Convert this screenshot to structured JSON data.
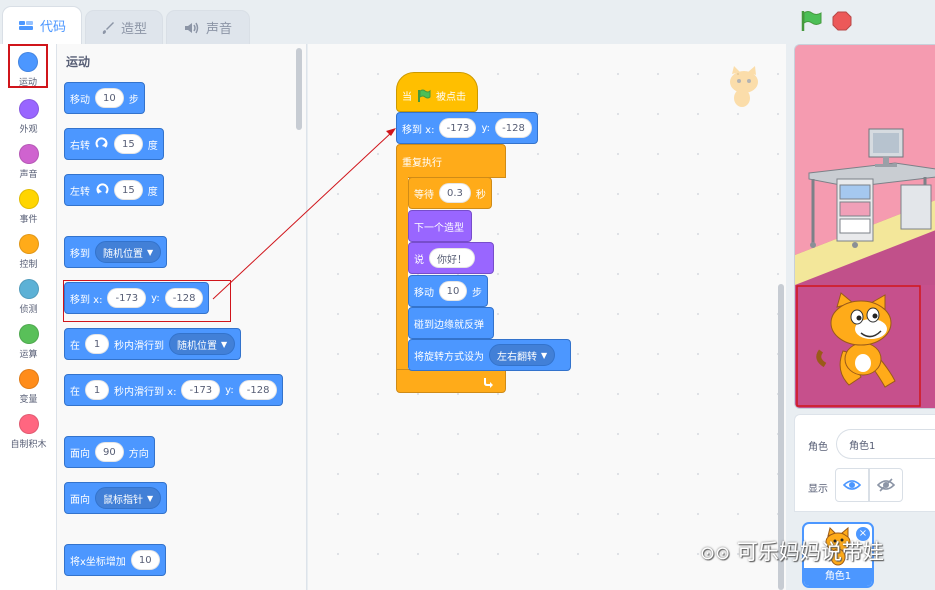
{
  "tabs": [
    {
      "label": "代码",
      "icon": "code-icon"
    },
    {
      "label": "造型",
      "icon": "brush-icon"
    },
    {
      "label": "声音",
      "icon": "speaker-icon"
    }
  ],
  "categories": [
    {
      "label": "运动",
      "color": "#4c97ff"
    },
    {
      "label": "外观",
      "color": "#9966ff"
    },
    {
      "label": "声音",
      "color": "#cf63cf"
    },
    {
      "label": "事件",
      "color": "#ffd500"
    },
    {
      "label": "控制",
      "color": "#ffab19"
    },
    {
      "label": "侦测",
      "color": "#5cb1d6"
    },
    {
      "label": "运算",
      "color": "#59c059"
    },
    {
      "label": "变量",
      "color": "#ff8c1a"
    },
    {
      "label": "自制积木",
      "color": "#ff6680"
    }
  ],
  "palette": {
    "title": "运动",
    "move": {
      "a": "移动",
      "v": "10",
      "b": "步"
    },
    "turn_right": {
      "a": "右转",
      "v": "15",
      "b": "度"
    },
    "turn_left": {
      "a": "左转",
      "v": "15",
      "b": "度"
    },
    "goto_random": {
      "a": "移到",
      "d": "随机位置"
    },
    "goto_xy": {
      "a": "移到 x:",
      "x": "-173",
      "yl": "y:",
      "y": "-128"
    },
    "glide_random": {
      "a": "在",
      "v": "1",
      "b": "秒内滑行到",
      "d": "随机位置"
    },
    "glide_xy": {
      "a": "在",
      "v": "1",
      "b": "秒内滑行到 x:",
      "x": "-173",
      "yl": "y:",
      "y": "-128"
    },
    "point_dir": {
      "a": "面向",
      "v": "90",
      "b": "方向"
    },
    "point_toward": {
      "a": "面向",
      "d": "鼠标指针"
    },
    "change_x": {
      "a": "将x坐标增加",
      "v": "10"
    }
  },
  "script": {
    "hat": {
      "a": "当",
      "b": "被点击"
    },
    "goto_xy": {
      "a": "移到 x:",
      "x": "-173",
      "yl": "y:",
      "y": "-128"
    },
    "forever": "重复执行",
    "wait": {
      "a": "等待",
      "v": "0.3",
      "b": "秒"
    },
    "next_costume": "下一个造型",
    "say": {
      "a": "说",
      "v": "你好！"
    },
    "move": {
      "a": "移动",
      "v": "10",
      "b": "步"
    },
    "bounce": "碰到边缘就反弹",
    "rotation": {
      "a": "将旋转方式设为",
      "d": "左右翻转"
    }
  },
  "sprite_info": {
    "sprite_label": "角色",
    "sprite_name": "角色1",
    "show_label": "显示",
    "tile_name": "角色1"
  },
  "watermark": "可乐妈妈说带娃",
  "colors": {
    "motion": "#4c97ff",
    "looks": "#9966ff",
    "events": "#ffbf00",
    "control": "#ffab19",
    "highlight": "#d0151b"
  }
}
